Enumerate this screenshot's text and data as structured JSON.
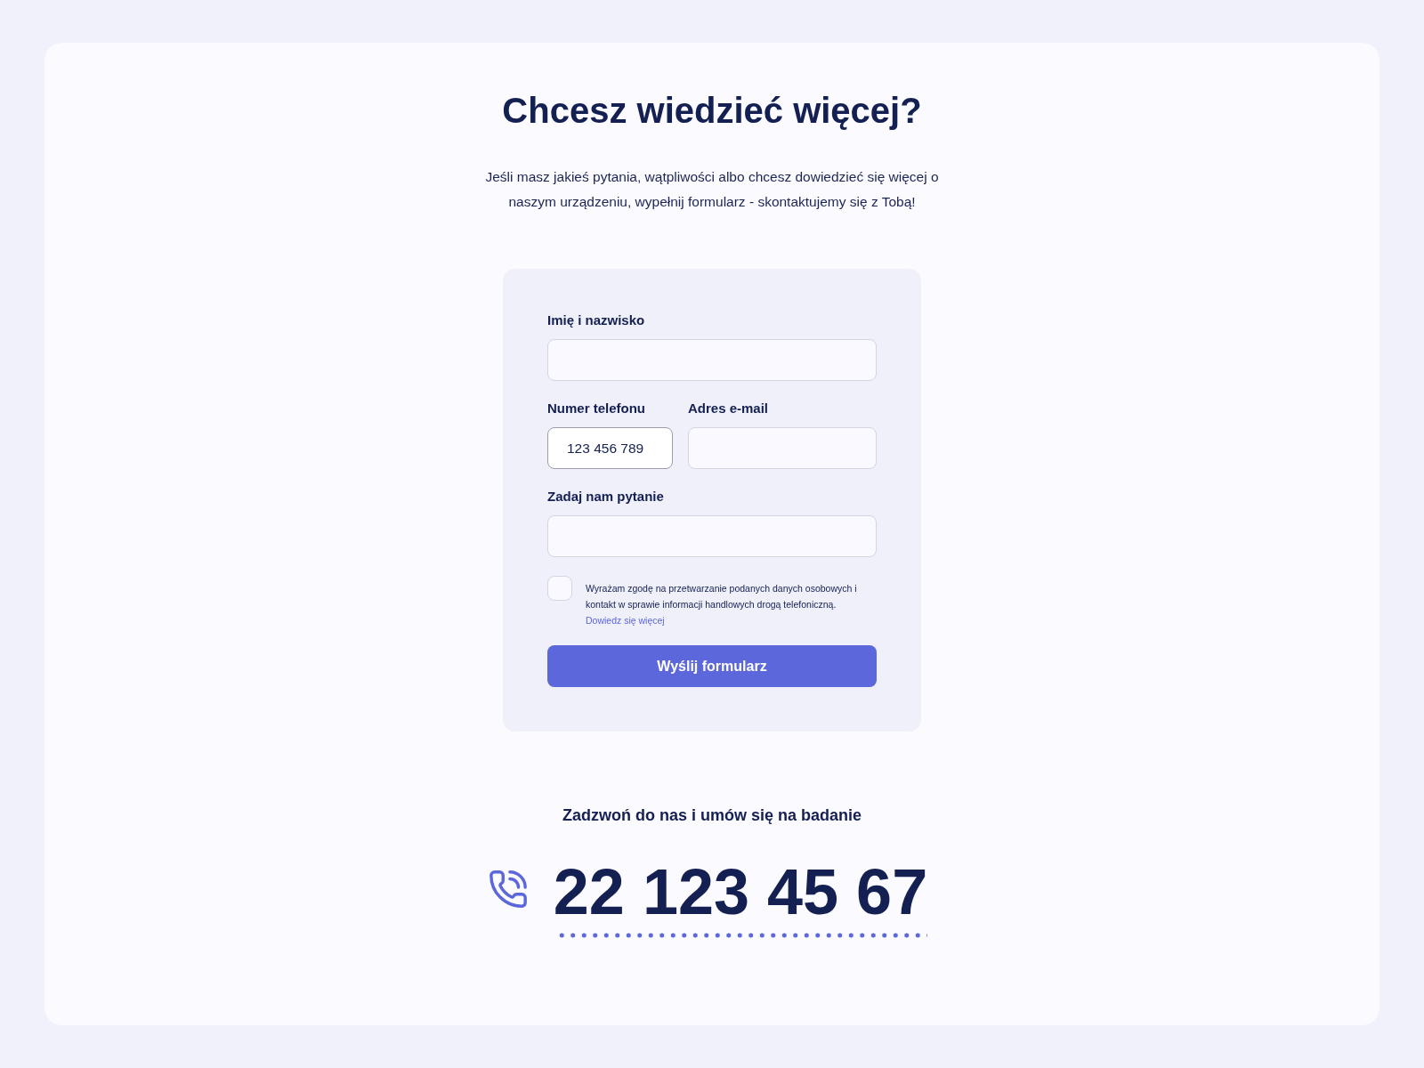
{
  "header": {
    "title": "Chcesz wiedzieć więcej?",
    "description": "Jeśli masz jakieś pytania, wątpliwości albo chcesz dowiedzieć się więcej o naszym urządzeniu, wypełnij formularz - skontaktujemy się z Tobą!"
  },
  "form": {
    "rows": [
      [
        {
          "label": "Imię i nazwisko"
        }
      ],
      [
        {
          "label": "Numer telefonu",
          "value": "123 456 789"
        },
        {
          "label": "Adres e-mail"
        }
      ],
      [
        {
          "label": "Zadaj nam pytanie"
        }
      ]
    ],
    "consent": {
      "checked": false,
      "text": "Wyrażam zgodę na przetwarzanie podanych danych osobowych i kontakt w sprawie informacji handlowych drogą telefoniczną.",
      "link": "Dowiedz się więcej"
    },
    "submit": "Wyślij formularz"
  },
  "contact": {
    "prompt": "Zadzwoń do nas i umów się na badanie",
    "phone": "22 123 45 67"
  }
}
